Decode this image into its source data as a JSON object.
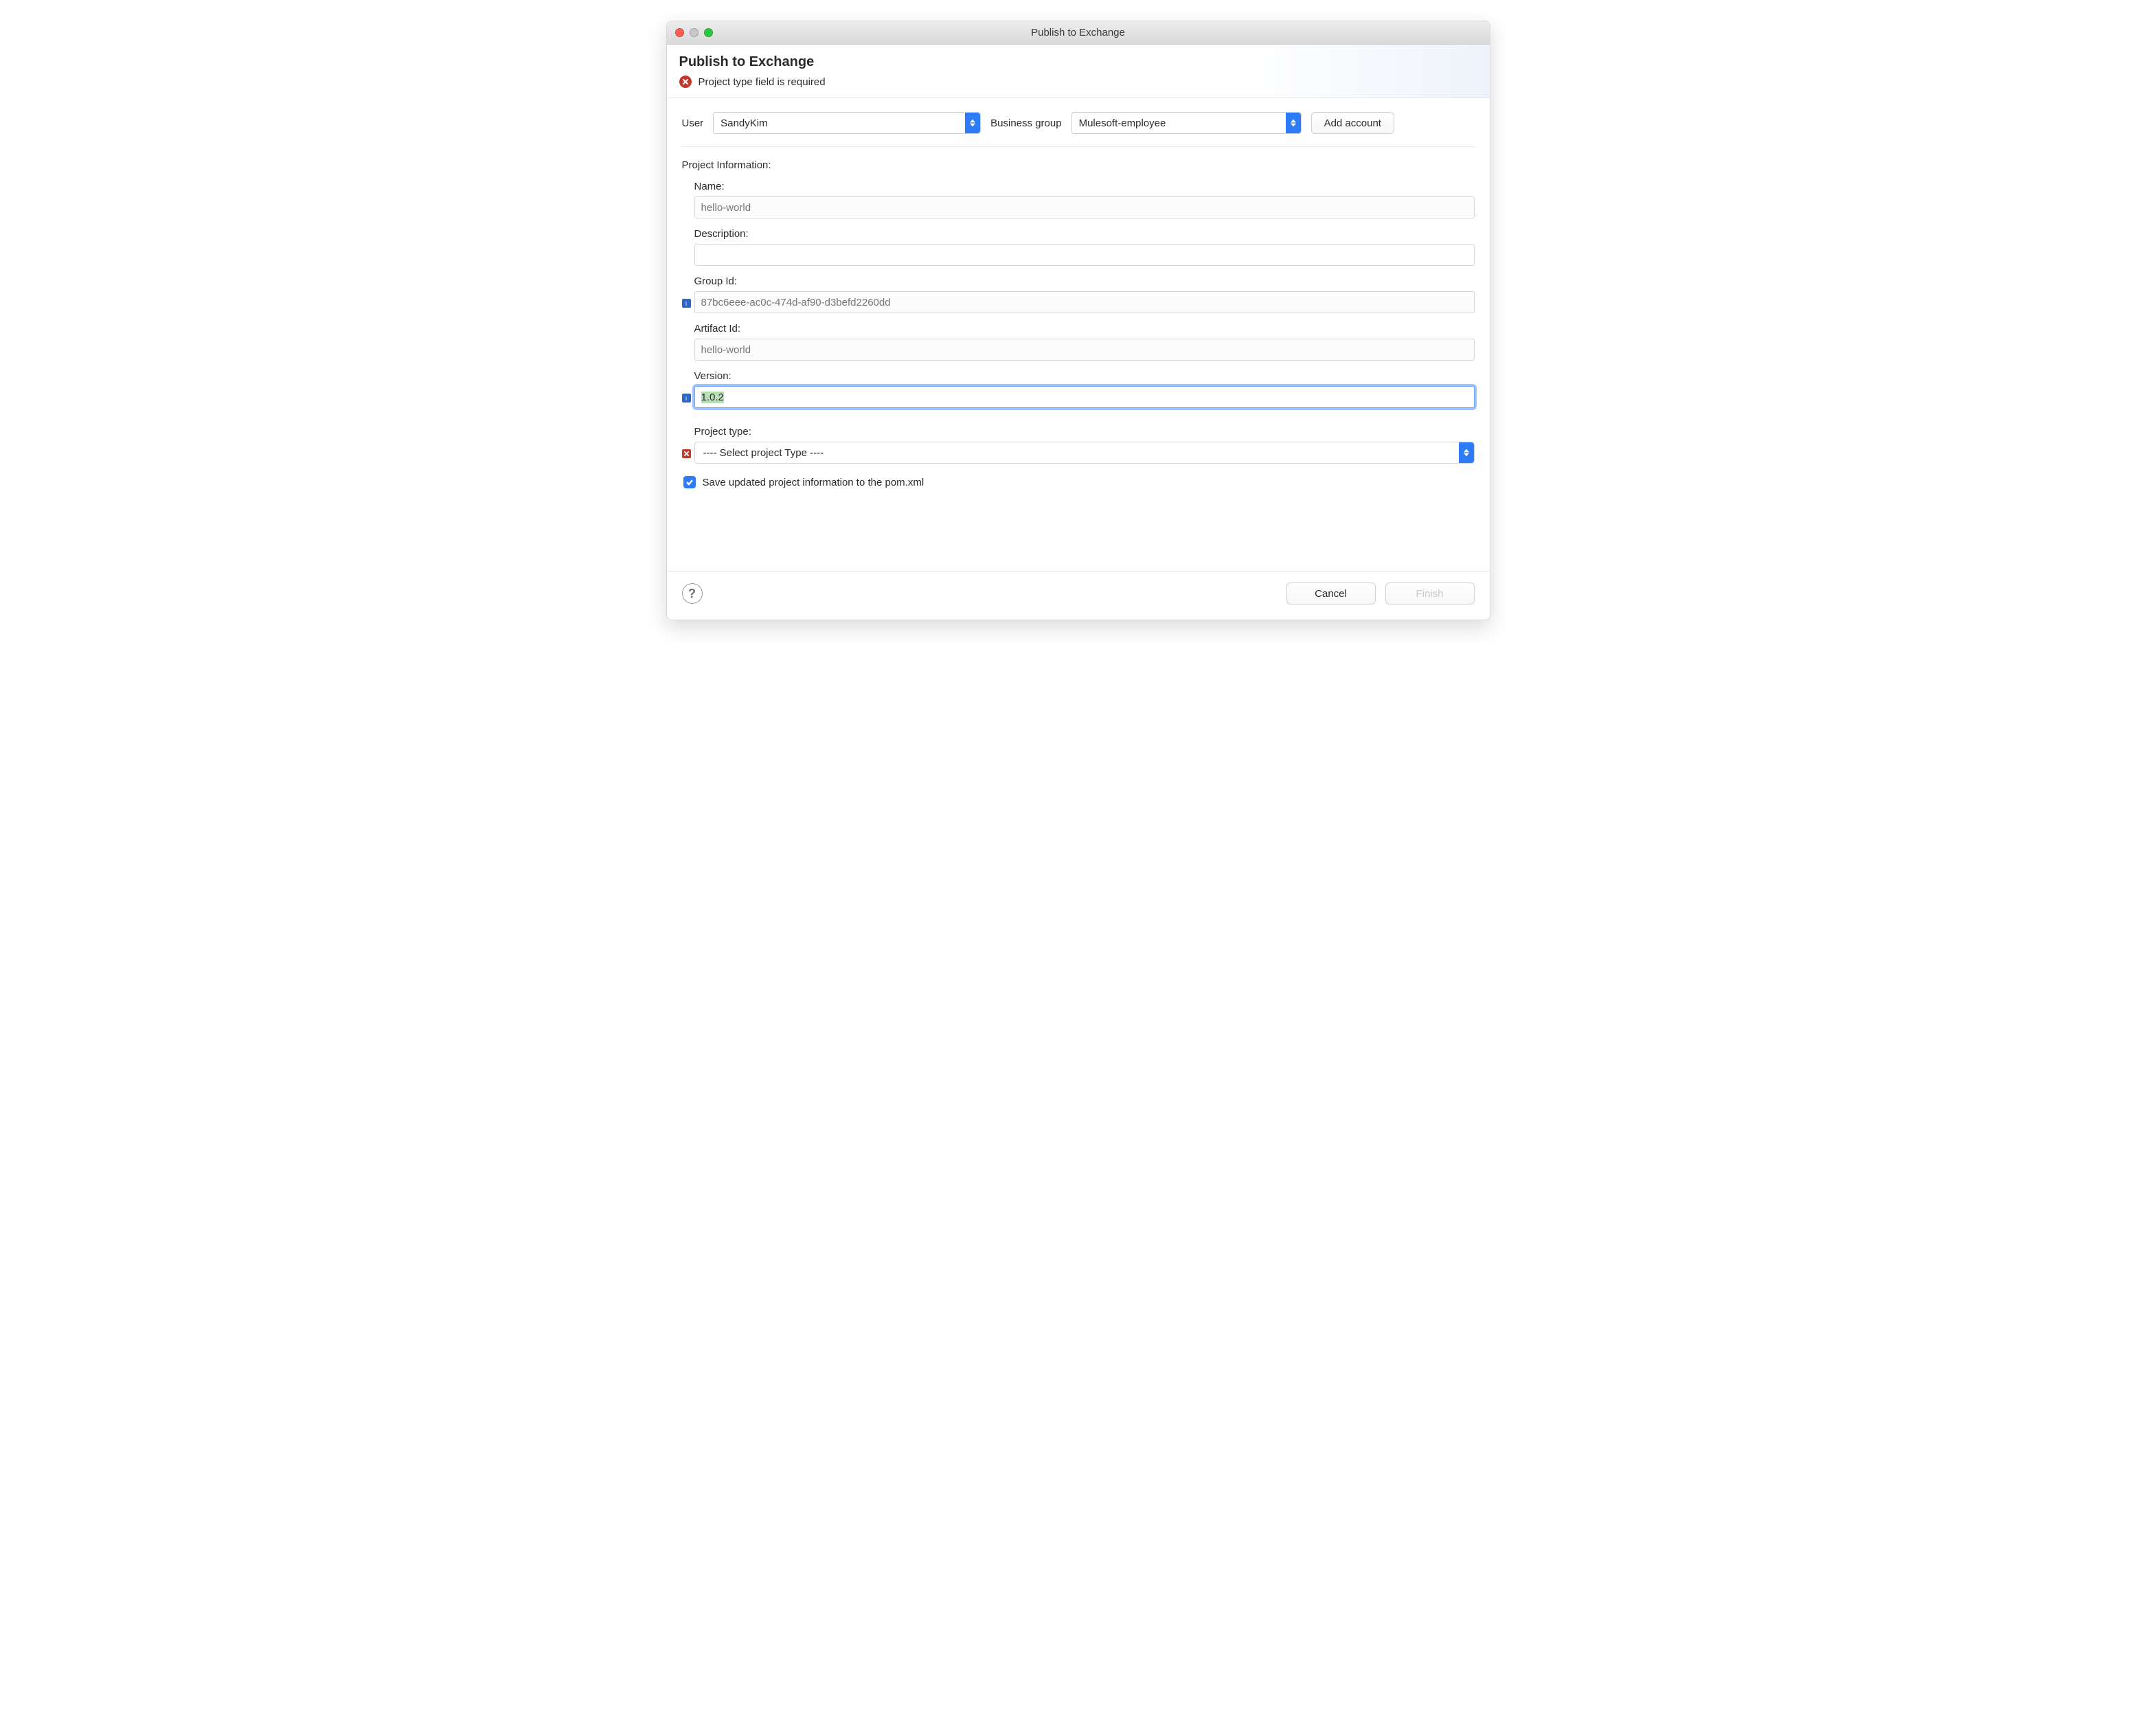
{
  "window": {
    "title": "Publish to Exchange"
  },
  "header": {
    "heading": "Publish to Exchange",
    "error_message": "Project type field is required"
  },
  "account": {
    "user_label": "User",
    "user_selected": "SandyKim",
    "bg_label": "Business group",
    "bg_selected": "Mulesoft-employee",
    "add_account_label": "Add account"
  },
  "section": {
    "title": "Project Information:"
  },
  "fields": {
    "name": {
      "label": "Name:",
      "placeholder": "hello-world",
      "value": ""
    },
    "description": {
      "label": "Description:",
      "value": ""
    },
    "group_id": {
      "label": "Group Id:",
      "placeholder": "87bc6eee-ac0c-474d-af90-d3befd2260dd",
      "value": ""
    },
    "artifact_id": {
      "label": "Artifact Id:",
      "placeholder": "hello-world",
      "value": ""
    },
    "version": {
      "label": "Version:",
      "value": "1.0.2"
    },
    "project_type": {
      "label": "Project type:",
      "selected": "---- Select project Type ----"
    }
  },
  "checkbox": {
    "label": "Save updated project information to the pom.xml",
    "checked": true
  },
  "footer": {
    "cancel": "Cancel",
    "finish": "Finish"
  },
  "icons": {
    "error": "x",
    "info": "i",
    "help": "?"
  },
  "colors": {
    "accent": "#2d7bf6",
    "error": "#c0392b",
    "info": "#2d66c9",
    "selection": "#b7e0b7"
  }
}
